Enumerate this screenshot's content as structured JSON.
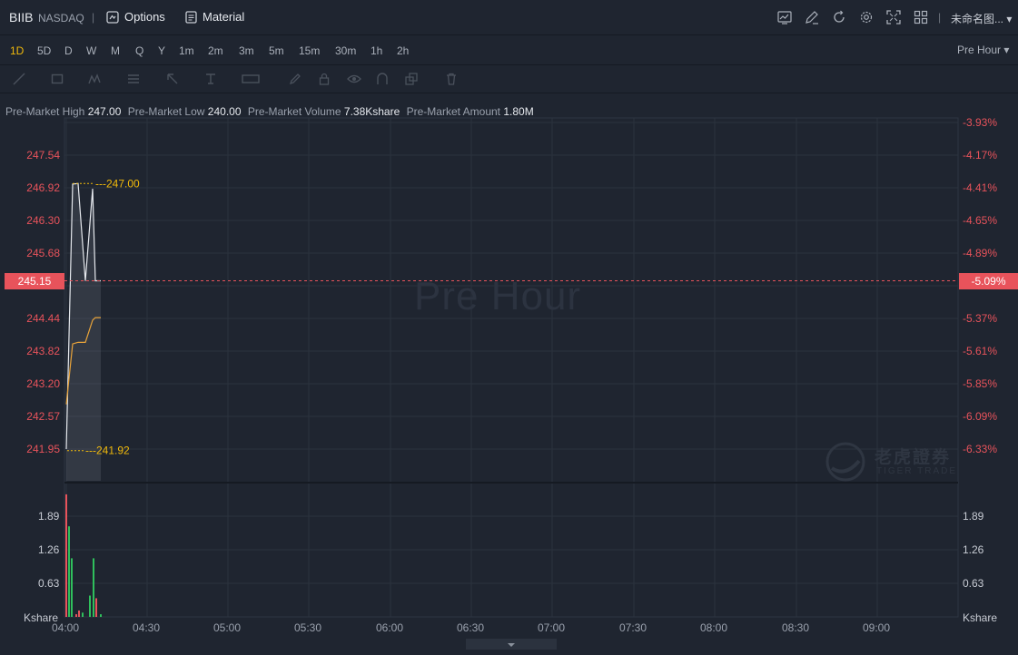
{
  "header": {
    "ticker": "BIIB",
    "exchange": "NASDAQ",
    "divider": "|",
    "options_label": "Options",
    "material_label": "Material",
    "chart_name": "未命名图... ▾"
  },
  "periods": [
    "1D",
    "5D",
    "D",
    "W",
    "M",
    "Q",
    "Y",
    "1m",
    "2m",
    "3m",
    "5m",
    "15m",
    "30m",
    "1h",
    "2h"
  ],
  "active_period": "1D",
  "session_select": "Pre Hour ▾",
  "stats": {
    "high_label": "Pre-Market High",
    "high_value": "247.00",
    "low_label": "Pre-Market Low",
    "low_value": "240.00",
    "volume_label": "Pre-Market Volume",
    "volume_value": "7.38Kshare",
    "amount_label": "Pre-Market Amount",
    "amount_value": "1.80M"
  },
  "watermark": "Pre Hour",
  "logo": {
    "cn": "老虎證券",
    "en": "TIGER TRADE"
  },
  "colors": {
    "bg": "#1f2530",
    "down": "#e8535b",
    "up": "#2fbf5c",
    "avg": "#e8a33a",
    "active": "#f0b90b"
  },
  "chart_data": {
    "type": "line",
    "price_axis_left": [
      "247.54",
      "246.92",
      "246.30",
      "245.68",
      "245.15",
      "244.44",
      "243.82",
      "243.20",
      "242.57",
      "241.95"
    ],
    "pct_axis_right": [
      "-3.93%",
      "-4.17%",
      "-4.41%",
      "-4.65%",
      "-4.89%",
      "-5.09%",
      "-5.37%",
      "-5.61%",
      "-5.85%",
      "-6.09%",
      "-6.33%"
    ],
    "x_ticks": [
      "04:00",
      "04:30",
      "05:00",
      "05:30",
      "06:00",
      "06:30",
      "07:00",
      "07:30",
      "08:00",
      "08:30",
      "09:00"
    ],
    "current_price": "245.15",
    "current_pct": "-5.09%",
    "high_marker": "247.00",
    "low_marker": "241.92",
    "volume_axis": [
      "1.89",
      "1.26",
      "0.63",
      "Kshare"
    ],
    "volume_unit": "Kshare",
    "price_series": [
      241.95,
      246.99,
      247.0,
      245.15,
      246.9,
      245.15,
      245.15
    ],
    "avg_series": [
      242.8,
      243.95,
      243.98,
      243.98,
      244.4,
      244.45,
      244.45
    ],
    "volume_values": [
      2.3,
      1.7,
      1.1,
      0.05,
      0.12,
      0.08,
      0.4,
      1.1,
      0.35,
      0.05
    ],
    "volume_colors": [
      "down",
      "up",
      "up",
      "down",
      "down",
      "up",
      "up",
      "up",
      "down",
      "up"
    ]
  }
}
